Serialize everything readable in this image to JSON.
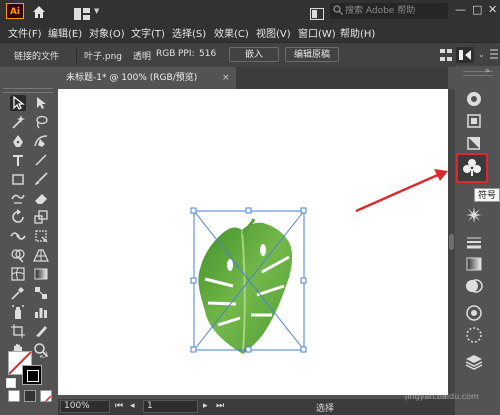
{
  "titlebar": {
    "app_logo": "Ai",
    "search_placeholder": "搜索 Adobe 帮助",
    "min": "—",
    "max": "□",
    "close": "✕"
  },
  "menu": [
    "文件(F)",
    "编辑(E)",
    "对象(O)",
    "文字(T)",
    "选择(S)",
    "效果(C)",
    "视图(V)",
    "窗口(W)",
    "帮助(H)"
  ],
  "control_bar": {
    "linked_file": "链接的文件",
    "filename": "叶子.png",
    "transparent": "透明",
    "colormode": "RGB",
    "ppi_label": "PPI:",
    "ppi_value": "516",
    "embed_button": "嵌入",
    "edit_original_button": "编辑原稿"
  },
  "document_tab": {
    "title": "未标题-1* @ 100% (RGB/预览)",
    "close": "×"
  },
  "tooltip": "符号",
  "status": {
    "zoom": "100%",
    "page": "1",
    "tool": "选择"
  },
  "watermark": {
    "logo": "Bai经验",
    "url": "jingyan.baidu.com"
  }
}
